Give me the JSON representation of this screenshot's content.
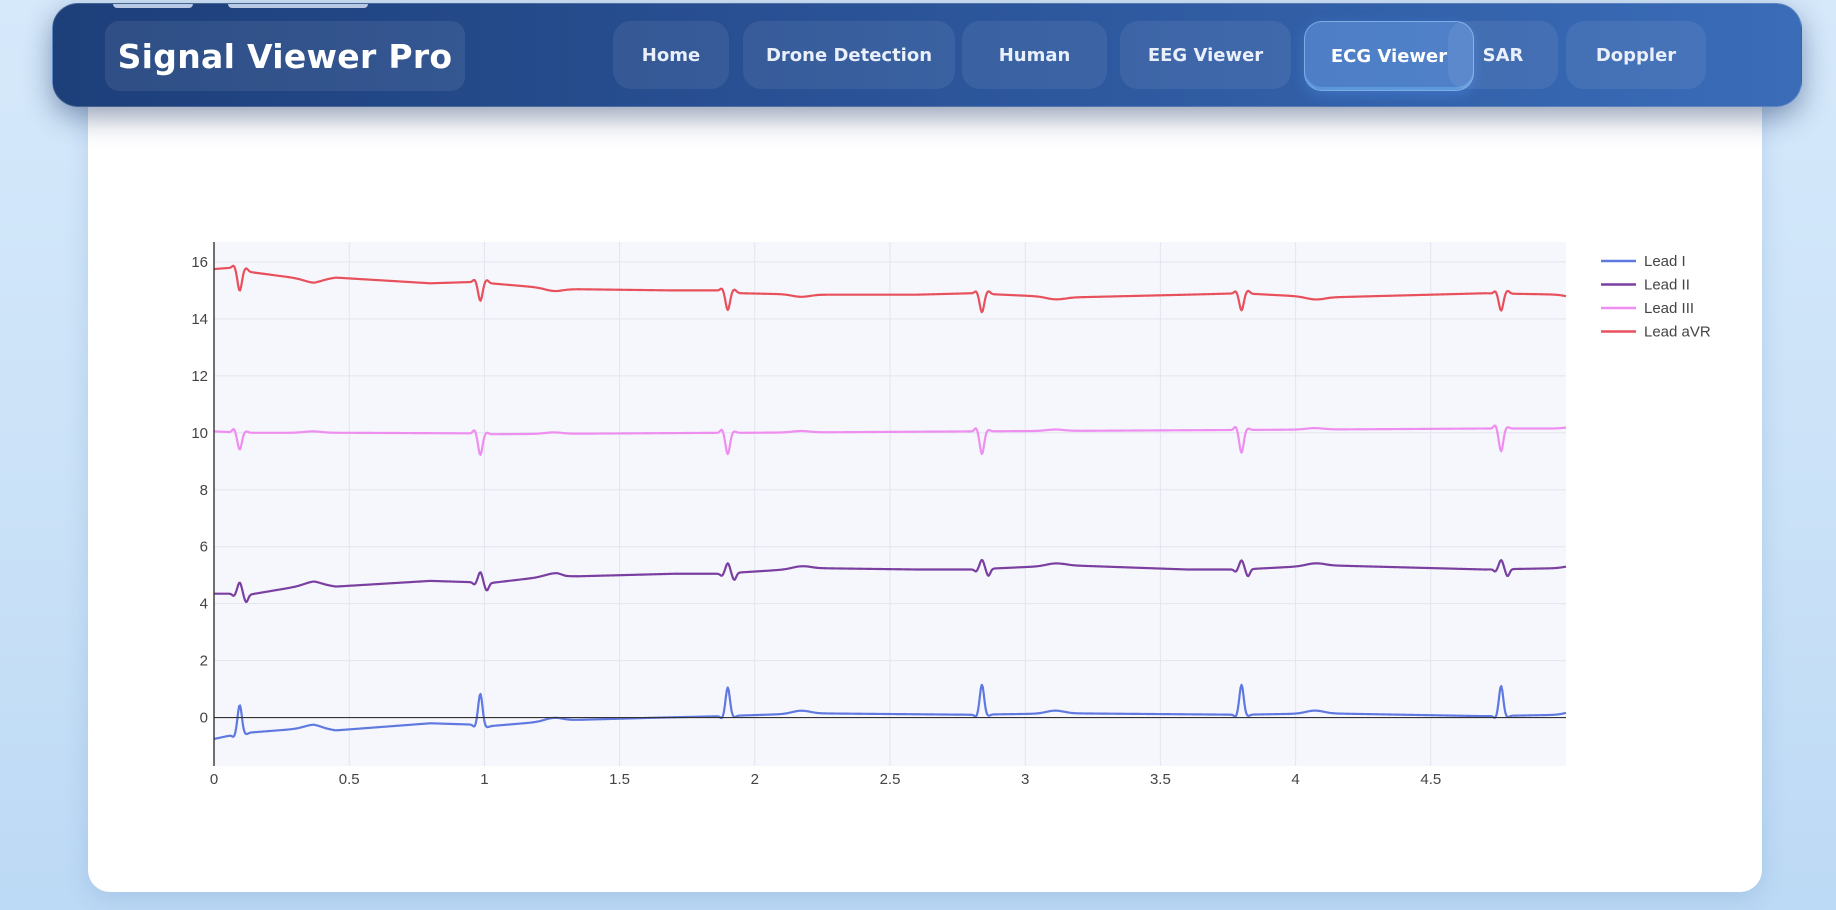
{
  "app": {
    "title": "Signal Viewer Pro"
  },
  "nav": {
    "items": [
      {
        "label": "Home",
        "active": false
      },
      {
        "label": "Drone Detection",
        "active": false
      },
      {
        "label": "Human",
        "active": false
      },
      {
        "label": "EEG Viewer",
        "active": false
      },
      {
        "label": "ECG Viewer",
        "active": true
      },
      {
        "label": "SAR",
        "active": false
      },
      {
        "label": "Doppler",
        "active": false
      }
    ]
  },
  "chart_data": {
    "type": "line",
    "title": "",
    "xlabel": "",
    "ylabel": "",
    "xlim": [
      0,
      5
    ],
    "ylim": [
      -1.7,
      16.7
    ],
    "x_ticks": [
      0,
      0.5,
      1,
      1.5,
      2,
      2.5,
      3,
      3.5,
      4,
      4.5
    ],
    "x_tick_labels": [
      "0",
      "0.5",
      "1",
      "1.5",
      "2",
      "2.5",
      "3",
      "3.5",
      "4",
      "4.5"
    ],
    "y_ticks": [
      0,
      2,
      4,
      6,
      8,
      10,
      12,
      14,
      16
    ],
    "y_tick_labels": [
      "0",
      "2",
      "4",
      "6",
      "8",
      "10",
      "12",
      "14",
      "16"
    ],
    "grid": true,
    "legend_position": "top-right",
    "beat_times": [
      0.095,
      0.985,
      1.9,
      2.84,
      3.8,
      4.76
    ],
    "series": [
      {
        "name": "Lead I",
        "color": "#6079e0",
        "baseline": [
          [
            0,
            -0.75
          ],
          [
            0.1,
            -0.55
          ],
          [
            0.37,
            -0.35
          ],
          [
            0.45,
            -0.45
          ],
          [
            0.8,
            -0.2
          ],
          [
            0.97,
            -0.25
          ],
          [
            1.02,
            -0.3
          ],
          [
            1.27,
            -0.1
          ],
          [
            1.65,
            0.0
          ],
          [
            1.88,
            0.05
          ],
          [
            2.2,
            0.15
          ],
          [
            2.8,
            0.1
          ],
          [
            3.15,
            0.15
          ],
          [
            3.8,
            0.1
          ],
          [
            4.1,
            0.15
          ],
          [
            4.7,
            0.05
          ],
          [
            5.0,
            0.1
          ]
        ],
        "qrs_amp": [
          1.0,
          1.1,
          1.0,
          1.05,
          1.05,
          1.05
        ],
        "q_depth": -0.08,
        "s_depth": -0.05,
        "t_amp": 0.1
      },
      {
        "name": "Lead II",
        "color": "#7a3fa0",
        "baseline": [
          [
            0,
            4.35
          ],
          [
            0.09,
            4.35
          ],
          [
            0.12,
            4.3
          ],
          [
            0.37,
            4.7
          ],
          [
            0.45,
            4.6
          ],
          [
            0.8,
            4.8
          ],
          [
            0.97,
            4.75
          ],
          [
            1.0,
            4.7
          ],
          [
            1.27,
            5.0
          ],
          [
            1.3,
            4.95
          ],
          [
            1.7,
            5.05
          ],
          [
            1.87,
            5.05
          ],
          [
            2.2,
            5.25
          ],
          [
            2.6,
            5.2
          ],
          [
            2.8,
            5.2
          ],
          [
            3.15,
            5.35
          ],
          [
            3.6,
            5.2
          ],
          [
            3.8,
            5.2
          ],
          [
            4.1,
            5.35
          ],
          [
            4.7,
            5.2
          ],
          [
            5.0,
            5.25
          ]
        ],
        "qrs_amp": [
          0.4,
          0.38,
          0.35,
          0.32,
          0.32,
          0.32
        ],
        "q_depth": -0.08,
        "s_depth": -0.25,
        "t_amp": 0.08
      },
      {
        "name": "Lead III",
        "color": "#ee8ef0",
        "baseline": [
          [
            0,
            10.05
          ],
          [
            0.12,
            10.0
          ],
          [
            0.5,
            10.0
          ],
          [
            0.97,
            9.98
          ],
          [
            1.02,
            9.95
          ],
          [
            1.87,
            10.0
          ],
          [
            1.95,
            10.0
          ],
          [
            2.8,
            10.05
          ],
          [
            3.8,
            10.1
          ],
          [
            4.7,
            10.15
          ],
          [
            5.0,
            10.15
          ]
        ],
        "qrs_amp": [
          -0.6,
          -0.75,
          -0.75,
          -0.8,
          -0.8,
          -0.8
        ],
        "q_depth": 0.12,
        "s_depth": 0.05,
        "t_amp": 0.05
      },
      {
        "name": "Lead aVR",
        "color": "#e8505c",
        "baseline": [
          [
            0,
            15.75
          ],
          [
            0.07,
            15.8
          ],
          [
            0.13,
            15.65
          ],
          [
            0.37,
            15.35
          ],
          [
            0.45,
            15.45
          ],
          [
            0.8,
            15.25
          ],
          [
            0.97,
            15.3
          ],
          [
            1.02,
            15.25
          ],
          [
            1.27,
            15.05
          ],
          [
            1.7,
            15.0
          ],
          [
            1.87,
            15.0
          ],
          [
            1.95,
            14.9
          ],
          [
            2.2,
            14.85
          ],
          [
            2.6,
            14.85
          ],
          [
            2.8,
            14.9
          ],
          [
            3.15,
            14.75
          ],
          [
            3.6,
            14.85
          ],
          [
            3.8,
            14.9
          ],
          [
            4.1,
            14.75
          ],
          [
            4.7,
            14.9
          ],
          [
            5.0,
            14.85
          ]
        ],
        "qrs_amp": [
          -0.75,
          -0.65,
          -0.65,
          -0.65,
          -0.6,
          -0.6
        ],
        "q_depth": 0.08,
        "s_depth": 0.1,
        "t_amp": -0.08
      }
    ]
  }
}
